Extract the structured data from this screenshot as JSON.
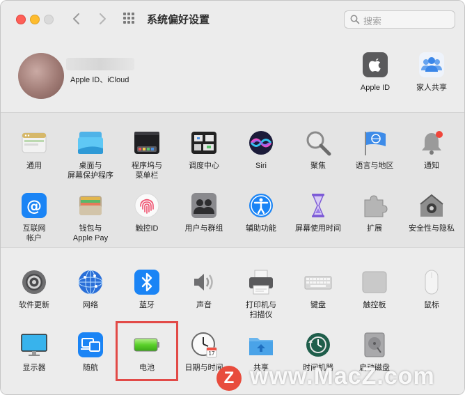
{
  "window": {
    "title": "系统偏好设置"
  },
  "search": {
    "placeholder": "搜索"
  },
  "account": {
    "subtitle": "Apple ID、iCloud"
  },
  "top_items": [
    {
      "label": "Apple ID",
      "icon": "apple-id-icon"
    },
    {
      "label": "家人共享",
      "icon": "family-sharing-icon"
    }
  ],
  "row1": [
    {
      "label": "通用",
      "icon": "general-icon"
    },
    {
      "label": "桌面与\n屏幕保护程序",
      "icon": "desktop-screensaver-icon"
    },
    {
      "label": "程序坞与\n菜单栏",
      "icon": "dock-menubar-icon"
    },
    {
      "label": "调度中心",
      "icon": "mission-control-icon"
    },
    {
      "label": "Siri",
      "icon": "siri-icon"
    },
    {
      "label": "聚焦",
      "icon": "spotlight-icon"
    },
    {
      "label": "语言与地区",
      "icon": "language-region-icon"
    },
    {
      "label": "通知",
      "icon": "notifications-icon"
    }
  ],
  "row2": [
    {
      "label": "互联网\n帐户",
      "icon": "internet-accounts-icon"
    },
    {
      "label": "钱包与\nApple Pay",
      "icon": "wallet-icon"
    },
    {
      "label": "触控ID",
      "icon": "touch-id-icon"
    },
    {
      "label": "用户与群组",
      "icon": "users-groups-icon"
    },
    {
      "label": "辅助功能",
      "icon": "accessibility-icon"
    },
    {
      "label": "屏幕使用时间",
      "icon": "screen-time-icon"
    },
    {
      "label": "扩展",
      "icon": "extensions-icon"
    },
    {
      "label": "安全性与隐私",
      "icon": "security-privacy-icon"
    }
  ],
  "row3": [
    {
      "label": "软件更新",
      "icon": "software-update-icon"
    },
    {
      "label": "网络",
      "icon": "network-icon"
    },
    {
      "label": "蓝牙",
      "icon": "bluetooth-icon"
    },
    {
      "label": "声音",
      "icon": "sound-icon"
    },
    {
      "label": "打印机与\n扫描仪",
      "icon": "printers-scanners-icon"
    },
    {
      "label": "键盘",
      "icon": "keyboard-icon"
    },
    {
      "label": "触控板",
      "icon": "trackpad-icon"
    },
    {
      "label": "鼠标",
      "icon": "mouse-icon"
    }
  ],
  "row4": [
    {
      "label": "显示器",
      "icon": "displays-icon"
    },
    {
      "label": "随航",
      "icon": "sidecar-icon"
    },
    {
      "label": "电池",
      "icon": "battery-icon"
    },
    {
      "label": "日期与时间",
      "icon": "date-time-icon"
    },
    {
      "label": "共享",
      "icon": "sharing-icon"
    },
    {
      "label": "时间机器",
      "icon": "time-machine-icon"
    },
    {
      "label": "启动磁盘",
      "icon": "startup-disk-icon"
    }
  ],
  "date_icon": {
    "day": "17"
  },
  "watermark": {
    "badge": "Z",
    "text": "www.MacZ.com"
  },
  "colors": {
    "highlight": "#e24a47",
    "accent": "#1a84f5"
  }
}
